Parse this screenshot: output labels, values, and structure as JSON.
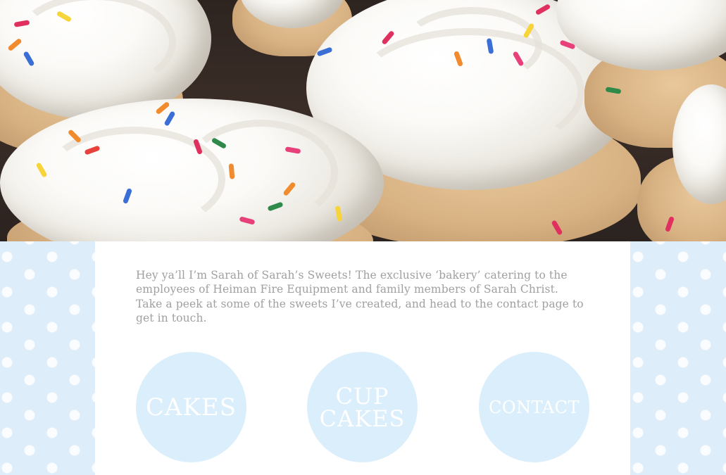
{
  "hero": {
    "image": "cupcakes-photo"
  },
  "intro": {
    "text": "Hey ya’ll I’m Sarah of Sarah’s Sweets! The exclusive ‘bakery’ catering to the employees of Heiman Fire Equipment and family members of Sarah Christ. Take a peek at some of the sweets I’ve created, and head to the contact page to get in touch."
  },
  "nav": {
    "cakes_label": "CAKES",
    "cupcakes_label": "CUP\nCAKES",
    "contact_label": "CONTACT"
  },
  "colors": {
    "circle": "#dbeefb",
    "side_pattern": "#ddedf9",
    "text": "#a0a0a0"
  }
}
